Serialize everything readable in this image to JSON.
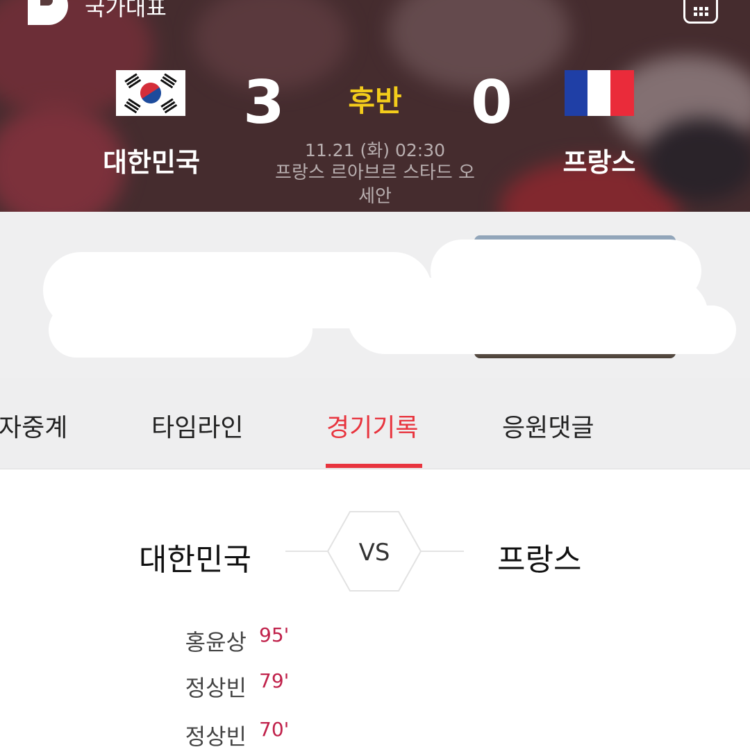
{
  "header": {
    "logo": "D",
    "title": "국가대표",
    "menu_icon": "grid-icon"
  },
  "match": {
    "home": {
      "name": "대한민국",
      "score": "3",
      "flag": "south-korea-flag-icon"
    },
    "away": {
      "name": "프랑스",
      "score": "0",
      "flag": "france-flag-icon"
    },
    "period": "후반",
    "date": "11.21 (화) 02:30",
    "venue_line1": "프랑스 르아브르 스타드 오",
    "venue_line2": "세안"
  },
  "tabs": [
    {
      "label": "문자중계",
      "visible_text": "자중계"
    },
    {
      "label": "타임라인"
    },
    {
      "label": "경기기록",
      "active": true
    },
    {
      "label": "응원댓글"
    }
  ],
  "record": {
    "home_team": "대한민국",
    "vs_label": "VS",
    "away_team": "프랑스",
    "goals": [
      {
        "player": "홍윤상",
        "minute": "95'"
      },
      {
        "player": "정상빈",
        "minute": "79'"
      },
      {
        "player": "정상빈",
        "minute": "70'"
      }
    ]
  },
  "colors": {
    "accent": "#e8343e",
    "period": "#f3cc1b",
    "minute": "#c0214a"
  }
}
